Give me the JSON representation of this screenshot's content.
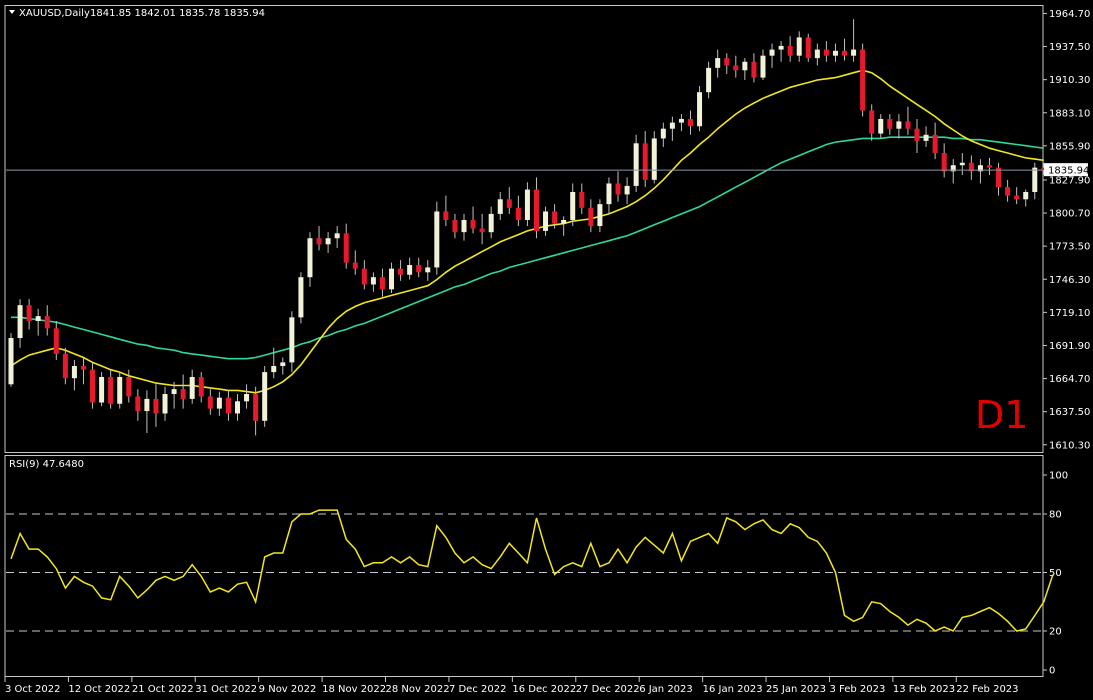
{
  "chart_data": [
    {
      "type": "candlestick",
      "symbol_label": "XAUUSD,Daily",
      "ohlc_label": "1841.85 1842.01 1835.78 1835.94",
      "timeframe_label": "D1",
      "current_price_label": "1835.94",
      "y_ticks": [
        "1964.70",
        "1937.50",
        "1910.30",
        "1883.10",
        "1855.90",
        "1827.90",
        "1800.70",
        "1773.50",
        "1746.30",
        "1719.10",
        "1691.90",
        "1664.70",
        "1637.50",
        "1610.30"
      ],
      "ylim": [
        1606,
        1970
      ],
      "x_ticks": [
        "3 Oct 2022",
        "12 Oct 2022",
        "21 Oct 2022",
        "31 Oct 2022",
        "9 Nov 2022",
        "18 Nov 2022",
        "28 Nov 2022",
        "7 Dec 2022",
        "16 Dec 2022",
        "27 Dec 2022",
        "6 Jan 2023",
        "16 Jan 2023",
        "25 Jan 2023",
        "3 Feb 2023",
        "13 Feb 2023",
        "22 Feb 2023"
      ],
      "x_tick_bar_index": [
        0,
        7,
        14,
        21,
        28,
        35,
        42,
        49,
        56,
        63,
        70,
        77,
        84,
        91,
        98,
        105
      ],
      "candles": [
        [
          1660,
          1702,
          1658,
          1698
        ],
        [
          1698,
          1730,
          1690,
          1725
        ],
        [
          1725,
          1730,
          1705,
          1712
        ],
        [
          1712,
          1722,
          1700,
          1716
        ],
        [
          1716,
          1725,
          1700,
          1706
        ],
        [
          1706,
          1712,
          1680,
          1685
        ],
        [
          1685,
          1690,
          1660,
          1665
        ],
        [
          1665,
          1680,
          1655,
          1675
        ],
        [
          1675,
          1682,
          1660,
          1672
        ],
        [
          1672,
          1678,
          1640,
          1645
        ],
        [
          1645,
          1670,
          1642,
          1666
        ],
        [
          1666,
          1672,
          1640,
          1644
        ],
        [
          1644,
          1670,
          1640,
          1666
        ],
        [
          1666,
          1672,
          1645,
          1650
        ],
        [
          1650,
          1656,
          1630,
          1638
        ],
        [
          1638,
          1655,
          1620,
          1648
        ],
        [
          1648,
          1660,
          1625,
          1636
        ],
        [
          1636,
          1658,
          1630,
          1652
        ],
        [
          1652,
          1662,
          1640,
          1656
        ],
        [
          1656,
          1668,
          1640,
          1648
        ],
        [
          1648,
          1672,
          1644,
          1666
        ],
        [
          1666,
          1670,
          1645,
          1650
        ],
        [
          1650,
          1656,
          1635,
          1640
        ],
        [
          1640,
          1654,
          1634,
          1649
        ],
        [
          1649,
          1655,
          1630,
          1636
        ],
        [
          1636,
          1652,
          1630,
          1646
        ],
        [
          1646,
          1660,
          1640,
          1652
        ],
        [
          1652,
          1658,
          1618,
          1630
        ],
        [
          1630,
          1675,
          1625,
          1670
        ],
        [
          1670,
          1690,
          1665,
          1675
        ],
        [
          1675,
          1682,
          1668,
          1678
        ],
        [
          1678,
          1720,
          1670,
          1715
        ],
        [
          1715,
          1752,
          1710,
          1748
        ],
        [
          1748,
          1785,
          1740,
          1780
        ],
        [
          1780,
          1790,
          1770,
          1775
        ],
        [
          1775,
          1785,
          1768,
          1780
        ],
        [
          1780,
          1790,
          1772,
          1784
        ],
        [
          1784,
          1792,
          1755,
          1760
        ],
        [
          1760,
          1770,
          1750,
          1755
        ],
        [
          1755,
          1762,
          1738,
          1742
        ],
        [
          1742,
          1752,
          1736,
          1748
        ],
        [
          1748,
          1755,
          1732,
          1738
        ],
        [
          1738,
          1760,
          1735,
          1755
        ],
        [
          1755,
          1762,
          1745,
          1750
        ],
        [
          1750,
          1764,
          1746,
          1758
        ],
        [
          1758,
          1764,
          1748,
          1752
        ],
        [
          1752,
          1762,
          1745,
          1756
        ],
        [
          1756,
          1810,
          1750,
          1802
        ],
        [
          1802,
          1815,
          1790,
          1795
        ],
        [
          1795,
          1800,
          1780,
          1785
        ],
        [
          1785,
          1800,
          1778,
          1795
        ],
        [
          1795,
          1806,
          1784,
          1788
        ],
        [
          1788,
          1800,
          1775,
          1785
        ],
        [
          1785,
          1806,
          1780,
          1800
        ],
        [
          1800,
          1818,
          1795,
          1812
        ],
        [
          1812,
          1822,
          1800,
          1805
        ],
        [
          1805,
          1815,
          1790,
          1795
        ],
        [
          1795,
          1826,
          1790,
          1820
        ],
        [
          1820,
          1830,
          1780,
          1786
        ],
        [
          1786,
          1806,
          1782,
          1802
        ],
        [
          1802,
          1808,
          1788,
          1792
        ],
        [
          1792,
          1798,
          1782,
          1795
        ],
        [
          1795,
          1825,
          1790,
          1818
        ],
        [
          1818,
          1825,
          1800,
          1805
        ],
        [
          1805,
          1812,
          1785,
          1790
        ],
        [
          1790,
          1812,
          1785,
          1808
        ],
        [
          1808,
          1830,
          1800,
          1825
        ],
        [
          1825,
          1835,
          1810,
          1816
        ],
        [
          1816,
          1830,
          1808,
          1823
        ],
        [
          1823,
          1865,
          1818,
          1858
        ],
        [
          1858,
          1868,
          1822,
          1828
        ],
        [
          1828,
          1868,
          1825,
          1862
        ],
        [
          1862,
          1875,
          1855,
          1870
        ],
        [
          1870,
          1880,
          1860,
          1875
        ],
        [
          1875,
          1882,
          1868,
          1878
        ],
        [
          1878,
          1885,
          1865,
          1872
        ],
        [
          1872,
          1905,
          1868,
          1900
        ],
        [
          1900,
          1925,
          1895,
          1920
        ],
        [
          1920,
          1935,
          1912,
          1928
        ],
        [
          1928,
          1932,
          1915,
          1922
        ],
        [
          1922,
          1930,
          1912,
          1918
        ],
        [
          1918,
          1928,
          1910,
          1925
        ],
        [
          1925,
          1932,
          1908,
          1912
        ],
        [
          1912,
          1935,
          1910,
          1930
        ],
        [
          1930,
          1940,
          1920,
          1935
        ],
        [
          1935,
          1942,
          1925,
          1938
        ],
        [
          1938,
          1946,
          1925,
          1930
        ],
        [
          1930,
          1950,
          1925,
          1945
        ],
        [
          1945,
          1948,
          1925,
          1928
        ],
        [
          1928,
          1940,
          1922,
          1935
        ],
        [
          1935,
          1942,
          1925,
          1930
        ],
        [
          1930,
          1940,
          1925,
          1934
        ],
        [
          1934,
          1944,
          1926,
          1930
        ],
        [
          1930,
          1960,
          1925,
          1935
        ],
        [
          1935,
          1940,
          1880,
          1885
        ],
        [
          1885,
          1890,
          1860,
          1866
        ],
        [
          1866,
          1882,
          1862,
          1878
        ],
        [
          1878,
          1882,
          1865,
          1870
        ],
        [
          1870,
          1882,
          1862,
          1876
        ],
        [
          1876,
          1888,
          1865,
          1870
        ],
        [
          1870,
          1878,
          1850,
          1860
        ],
        [
          1860,
          1872,
          1855,
          1865
        ],
        [
          1865,
          1875,
          1845,
          1850
        ],
        [
          1850,
          1858,
          1830,
          1835
        ],
        [
          1835,
          1845,
          1825,
          1840
        ],
        [
          1840,
          1850,
          1832,
          1842
        ],
        [
          1842,
          1848,
          1828,
          1835
        ],
        [
          1835,
          1845,
          1825,
          1840
        ],
        [
          1840,
          1846,
          1832,
          1838
        ],
        [
          1838,
          1842,
          1815,
          1822
        ],
        [
          1822,
          1828,
          1810,
          1815
        ],
        [
          1815,
          1822,
          1808,
          1812
        ],
        [
          1812,
          1820,
          1806,
          1818
        ],
        [
          1818,
          1842,
          1812,
          1838
        ],
        [
          1838,
          1842,
          1832,
          1836
        ]
      ],
      "ma_fast": [
        1675,
        1680,
        1684,
        1686,
        1688,
        1690,
        1688,
        1685,
        1682,
        1678,
        1675,
        1672,
        1670,
        1667,
        1665,
        1663,
        1661,
        1660,
        1659,
        1659,
        1659,
        1658,
        1657,
        1656,
        1655,
        1655,
        1654,
        1653,
        1655,
        1658,
        1662,
        1668,
        1676,
        1686,
        1696,
        1706,
        1714,
        1720,
        1724,
        1727,
        1729,
        1731,
        1733,
        1735,
        1737,
        1739,
        1741,
        1746,
        1752,
        1757,
        1761,
        1765,
        1769,
        1773,
        1777,
        1780,
        1783,
        1786,
        1788,
        1790,
        1791,
        1792,
        1794,
        1795,
        1796,
        1798,
        1800,
        1803,
        1806,
        1810,
        1815,
        1821,
        1828,
        1836,
        1844,
        1850,
        1857,
        1863,
        1870,
        1876,
        1882,
        1887,
        1891,
        1895,
        1898,
        1901,
        1904,
        1906,
        1908,
        1910,
        1911,
        1912,
        1914,
        1916,
        1918,
        1916,
        1911,
        1905,
        1900,
        1895,
        1890,
        1885,
        1880,
        1874,
        1869,
        1864,
        1860,
        1857,
        1854,
        1852,
        1850,
        1848,
        1846,
        1845,
        1844
      ],
      "ma_slow": [
        1715,
        1715,
        1714,
        1713,
        1712,
        1711,
        1709,
        1707,
        1705,
        1703,
        1701,
        1699,
        1697,
        1695,
        1693,
        1692,
        1690,
        1689,
        1688,
        1686,
        1685,
        1684,
        1683,
        1682,
        1681,
        1681,
        1681,
        1682,
        1684,
        1686,
        1688,
        1690,
        1693,
        1695,
        1698,
        1700,
        1703,
        1705,
        1708,
        1710,
        1713,
        1716,
        1719,
        1722,
        1725,
        1728,
        1731,
        1734,
        1737,
        1740,
        1742,
        1745,
        1748,
        1751,
        1753,
        1756,
        1758,
        1760,
        1762,
        1764,
        1766,
        1768,
        1770,
        1772,
        1774,
        1776,
        1778,
        1780,
        1782,
        1785,
        1788,
        1791,
        1794,
        1797,
        1800,
        1803,
        1806,
        1810,
        1814,
        1818,
        1822,
        1826,
        1830,
        1834,
        1838,
        1842,
        1845,
        1848,
        1851,
        1854,
        1857,
        1859,
        1860,
        1861,
        1862,
        1862,
        1862,
        1863,
        1863,
        1863,
        1863,
        1863,
        1863,
        1863,
        1862,
        1862,
        1861,
        1861,
        1860,
        1859,
        1858,
        1857,
        1856,
        1855,
        1854
      ]
    },
    {
      "type": "line",
      "title": "RSI(9) 47.6480",
      "y_ticks": [
        "100",
        "80",
        "50",
        "20",
        "0"
      ],
      "levels": [
        80,
        50,
        20
      ],
      "ylim": [
        0,
        100
      ],
      "values": [
        57,
        70,
        62,
        62,
        58,
        52,
        42,
        48,
        45,
        43,
        37,
        36,
        48,
        43,
        37,
        41,
        46,
        48,
        46,
        48,
        54,
        48,
        40,
        42,
        40,
        44,
        45,
        35,
        58,
        60,
        60,
        76,
        80,
        80,
        82,
        82,
        82,
        67,
        62,
        53,
        55,
        55,
        58,
        55,
        58,
        54,
        53,
        74,
        68,
        60,
        55,
        58,
        54,
        52,
        58,
        65,
        60,
        55,
        78,
        62,
        49,
        53,
        55,
        53,
        65,
        53,
        55,
        62,
        55,
        63,
        68,
        64,
        60,
        70,
        56,
        66,
        68,
        70,
        65,
        78,
        76,
        72,
        75,
        77,
        72,
        70,
        75,
        73,
        68,
        66,
        60,
        50,
        28,
        25,
        27,
        35,
        34,
        30,
        27,
        23,
        26,
        24,
        20,
        22,
        20,
        27,
        28,
        30,
        32,
        29,
        25,
        20,
        21,
        28,
        35,
        49
      ]
    }
  ]
}
